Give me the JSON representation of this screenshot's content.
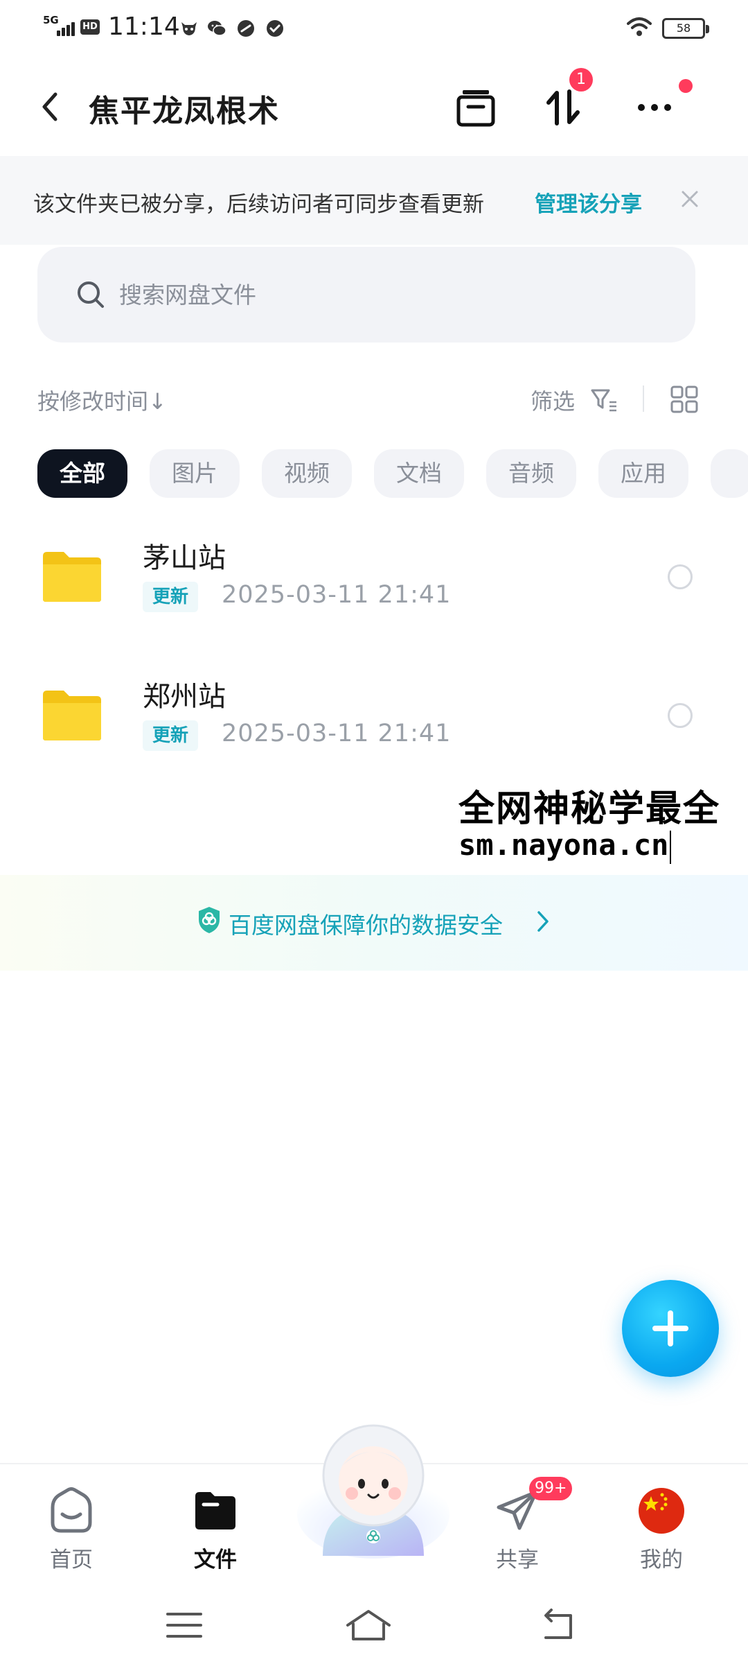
{
  "status_bar": {
    "network": "5G",
    "hd": "HD",
    "time": "11:14",
    "battery": "58"
  },
  "header": {
    "title": "焦平龙凤根术",
    "transfer_badge": "1"
  },
  "notice": {
    "text": "该文件夹已被分享，后续访问者可同步查看更新",
    "link": "管理该分享"
  },
  "search": {
    "placeholder": "搜索网盘文件"
  },
  "sort": {
    "label": "按修改时间↓",
    "filter_label": "筛选"
  },
  "tabs": [
    "全部",
    "图片",
    "视频",
    "文档",
    "音频",
    "应用"
  ],
  "files": [
    {
      "name": "茅山站",
      "badge": "更新",
      "date": "2025-03-11  21:41"
    },
    {
      "name": "郑州站",
      "badge": "更新",
      "date": "2025-03-11  21:41"
    }
  ],
  "watermark": {
    "line1": "全网神秘学最全",
    "line2": "sm.nayona.cn"
  },
  "security_banner": {
    "text": "百度网盘保障你的数据安全"
  },
  "bottom_nav": {
    "items": [
      {
        "label": "首页",
        "icon": "home-face-icon"
      },
      {
        "label": "文件",
        "icon": "folder-icon",
        "active": true
      },
      {
        "label": "共享",
        "icon": "paper-plane-icon",
        "badge": "99+"
      },
      {
        "label": "我的",
        "icon": "avatar-flag-icon"
      }
    ]
  },
  "colors": {
    "accent": "#16a2b8",
    "badge_red": "#ff3b5c",
    "tab_active_bg": "#0e1420",
    "fab": "#0aa8f0",
    "folder": "#f8cf1e"
  }
}
